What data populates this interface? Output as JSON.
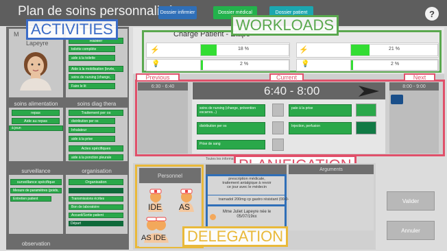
{
  "app": {
    "title": "Plan de soins personnalisé",
    "top_buttons": [
      "Dossier infirmier",
      "Dossier médical",
      "Dossier patient"
    ],
    "help_symbol": "?"
  },
  "overlays": {
    "activities": "ACTIVITIES",
    "workloads": "WORKLOADS",
    "planification": "PLANIFICATION",
    "delegation": "DELEGATION",
    "previous": "Previous",
    "current": "Current",
    "next": "Next"
  },
  "patient": {
    "name_initial": "M",
    "name": "Lapeyre"
  },
  "activities": {
    "top_select": "Habiller",
    "top_items": [
      "toilette complète",
      "aide à la toilette",
      "Aide à la mobilisation (levée,",
      "soins de nursing (change,",
      "Faire le lit"
    ],
    "alimentation": {
      "header": "soins alimentation",
      "select1": "repas",
      "select2": "Aide au repas",
      "items": [
        "à jeun"
      ]
    },
    "diag": {
      "header": "soins diag thera",
      "select1": "Traitement per os",
      "items": [
        "distribution per os",
        "Inhalateur",
        "aide à la prise"
      ],
      "select2": "Actes spécifiques",
      "items2": [
        "aide à la ponction pleurale"
      ]
    },
    "surveillance": {
      "header": "surveillance",
      "select": "surveillance spécifique",
      "items": [
        "Mesure de paramètres (poids,",
        "Entretien patient"
      ]
    },
    "organisation": {
      "header": "organisation",
      "select": "Organisation",
      "items": [
        "Transmissions écrites",
        "Bon de laboratoire",
        "Accueil/Sortie patient",
        "Départ"
      ]
    },
    "observation": {
      "header": "observation"
    }
  },
  "workloads": {
    "title": "Charge Patient - Étape",
    "rows": [
      {
        "left_pct": "18 %",
        "left_level": 0.18,
        "right_pct": "21 %",
        "right_level": 0.21
      },
      {
        "left_pct": "2 %",
        "left_level": 0.02,
        "right_pct": "2 %",
        "right_level": 0.02
      }
    ]
  },
  "planification": {
    "previous_time": "6:30 - 6:40",
    "current_time": "6:40 - 8:00",
    "next_time": "8:00 - 9:00",
    "left_tasks": [
      "soins de nursing (change, prévention escarres...)",
      "distribution per os",
      "Prise de sang"
    ],
    "right_tasks": [
      "pate à la prise",
      "Injection, perfusion"
    ],
    "footnote": "Toutes les informations"
  },
  "delegation": {
    "personnel_label": "Personnel",
    "roles": [
      "IDE",
      "AS",
      "AS IDE"
    ],
    "messages": [
      "prescription médicale, traitement antalgique à revoir ce jour avec le médecin",
      "tramadol 200mg cp gastro résistant (00-0-1)",
      "Mme Juliet Lapeyre née le 05/07/19xx"
    ],
    "arguments_label": "Arguments"
  },
  "side_buttons": {
    "validate": "Valider",
    "cancel": "Annuler"
  }
}
